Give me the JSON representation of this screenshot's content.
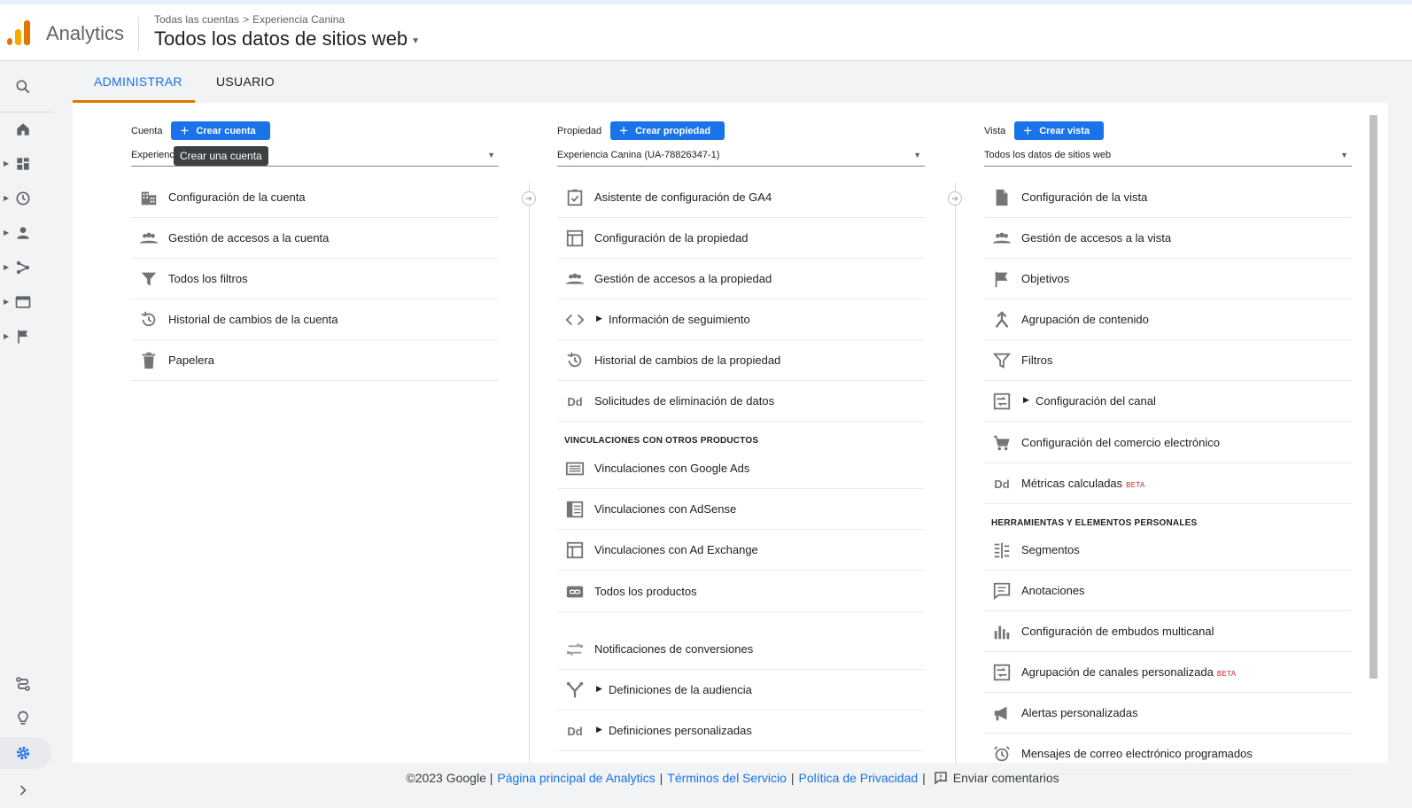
{
  "header": {
    "app_name": "Analytics",
    "breadcrumb": [
      "Todas las cuentas",
      ">",
      "Experiencia Canina"
    ],
    "view_title": "Todos los datos de sitios web"
  },
  "tabs": [
    {
      "label": "ADMINISTRAR",
      "active": true
    },
    {
      "label": "USUARIO",
      "active": false
    }
  ],
  "account": {
    "label": "Cuenta",
    "create_label": "Crear cuenta",
    "selected": "Experienc",
    "tooltip": "Crear una cuenta",
    "items": [
      {
        "label": "Configuración de la cuenta",
        "icon": "building-icon"
      },
      {
        "label": "Gestión de accesos a la cuenta",
        "icon": "people-icon"
      },
      {
        "label": "Todos los filtros",
        "icon": "filter-icon"
      },
      {
        "label": "Historial de cambios de la cuenta",
        "icon": "history-icon"
      },
      {
        "label": "Papelera",
        "icon": "trash-icon"
      }
    ]
  },
  "property": {
    "label": "Propiedad",
    "create_label": "Crear propiedad",
    "selected": "Experiencia Canina (UA-78826347-1)",
    "items": [
      {
        "label": "Asistente de configuración de GA4",
        "icon": "checkbox-icon"
      },
      {
        "label": "Configuración de la propiedad",
        "icon": "layout-icon"
      },
      {
        "label": "Gestión de accesos a la propiedad",
        "icon": "people-icon"
      },
      {
        "label": "Información de seguimiento",
        "icon": "code-icon",
        "expandable": true
      },
      {
        "label": "Historial de cambios de la propiedad",
        "icon": "history-icon"
      },
      {
        "label": "Solicitudes de eliminación de datos",
        "icon": "dd-icon"
      }
    ],
    "section": "VINCULACIONES CON OTROS PRODUCTOS",
    "links": [
      {
        "label": "Vinculaciones con Google Ads",
        "icon": "ads-icon"
      },
      {
        "label": "Vinculaciones con AdSense",
        "icon": "adsense-icon"
      },
      {
        "label": "Vinculaciones con Ad Exchange",
        "icon": "adexchange-icon"
      },
      {
        "label": "Todos los productos",
        "icon": "link-icon"
      }
    ],
    "more": [
      {
        "label": "Notificaciones de conversiones",
        "icon": "conversion-icon"
      },
      {
        "label": "Definiciones de la audiencia",
        "icon": "audience-icon",
        "expandable": true
      },
      {
        "label": "Definiciones personalizadas",
        "icon": "dd-icon",
        "expandable": true
      }
    ]
  },
  "view": {
    "label": "Vista",
    "create_label": "Crear vista",
    "selected": "Todos los datos de sitios web",
    "items": [
      {
        "label": "Configuración de la vista",
        "icon": "document-icon"
      },
      {
        "label": "Gestión de accesos a la vista",
        "icon": "people-icon"
      },
      {
        "label": "Objetivos",
        "icon": "flag-icon"
      },
      {
        "label": "Agrupación de contenido",
        "icon": "content-grouping-icon"
      },
      {
        "label": "Filtros",
        "icon": "filter-icon"
      },
      {
        "label": "Configuración del canal",
        "icon": "channel-icon",
        "expandable": true
      },
      {
        "label": "Configuración del comercio electrónico",
        "icon": "cart-icon"
      },
      {
        "label": "Métricas calculadas",
        "icon": "dd-icon",
        "badge": "BETA"
      }
    ],
    "section": "HERRAMIENTAS Y ELEMENTOS PERSONALES",
    "tools": [
      {
        "label": "Segmentos",
        "icon": "segments-icon"
      },
      {
        "label": "Anotaciones",
        "icon": "annotation-icon"
      },
      {
        "label": "Configuración de embudos multicanal",
        "icon": "bar-chart-icon"
      },
      {
        "label": "Agrupación de canales personalizada",
        "icon": "channel-icon",
        "badge": "BETA"
      },
      {
        "label": "Alertas personalizadas",
        "icon": "megaphone-icon"
      },
      {
        "label": "Mensajes de correo electrónico programados",
        "icon": "alarm-icon"
      }
    ]
  },
  "footer": {
    "copyright": "©2023 Google |",
    "link1": "Página principal de Analytics",
    "sep1": "|",
    "link2": "Términos del Servicio",
    "sep2": "|",
    "link3": "Política de Privacidad",
    "sep3": "|",
    "feedback": "Enviar comentarios"
  },
  "colors": {
    "accent": "#1a73e8",
    "brand_orange": "#e37400",
    "brand_yellow": "#f9ab00"
  }
}
